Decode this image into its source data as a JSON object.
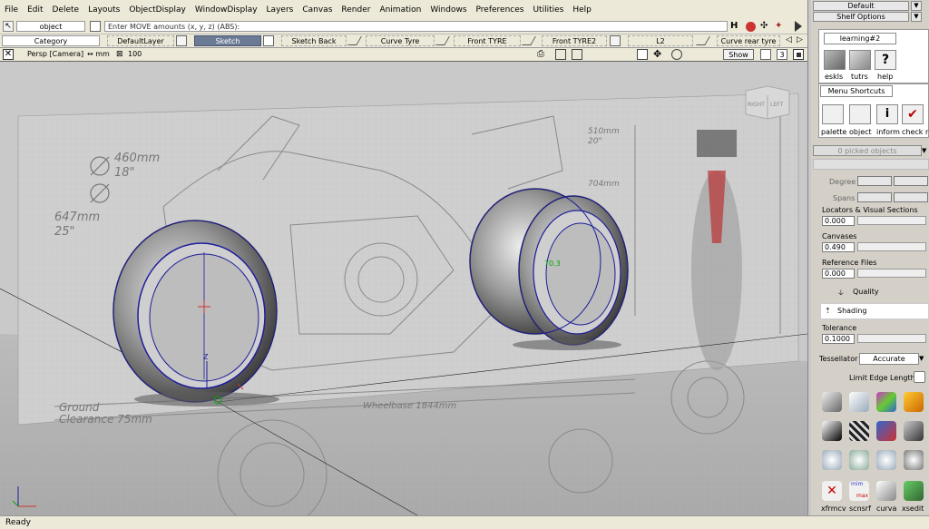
{
  "menu": [
    "File",
    "Edit",
    "Delete",
    "Layouts",
    "ObjectDisplay",
    "WindowDisplay",
    "Layers",
    "Canvas",
    "Render",
    "Animation",
    "Windows",
    "Preferences",
    "Utilities",
    "Help"
  ],
  "toolbar": {
    "pick_mode": "object",
    "move_prompt": "Enter MOVE amounts (x, y, z) (ABS):"
  },
  "layers": {
    "category": "Category",
    "items": [
      "DefaultLayer",
      "Sketch",
      "Sketch Back",
      "Curve Tyre",
      "Front TYRE",
      "Front TYRE2",
      "L2",
      "Curve rear tyre"
    ]
  },
  "viewport": {
    "camera": "Persp [Camera]",
    "units": "↔ mm",
    "zoom": "100",
    "show": "Show",
    "count": "3",
    "viewcube_faces": [
      "RIGHT",
      "LEFT"
    ],
    "annotations": [
      "460mm",
      "18\"",
      "647mm",
      "25\"",
      "510mm",
      "20\"",
      "704mm",
      "Ground",
      "Clearance 75mm",
      "Wheelbase 1844mm"
    ],
    "axis_label": "Z",
    "marker": "70.3"
  },
  "right_panel": {
    "layout": "Default",
    "shelf": "Shelf Options",
    "shelf_tab": "learning#2",
    "shelf_icons": [
      "eskls",
      "tutrs",
      "help"
    ],
    "menu_tab": "Menu Shortcuts",
    "menu_icons": [
      "palette",
      "object",
      "inform",
      "check r"
    ],
    "picked": "0 picked objects",
    "degree": "Degree",
    "spans": "Spans",
    "locators": "Locators & Visual Sections",
    "locators_val": "0.000",
    "canvases": "Canvases",
    "canvases_val": "0.490",
    "ref_files": "Reference Files",
    "ref_val": "0.000",
    "quality": "Quality",
    "shading": "Shading",
    "tolerance": "Tolerance",
    "tol_val": "0.1000",
    "tessellator": "Tessellator",
    "tess_val": "Accurate",
    "limit_edge": "Limit Edge Length",
    "bottom_icons": [
      "xfrmcv",
      "scnsrf",
      "curva",
      "xsedit"
    ],
    "bottom_badges": [
      "mim",
      "max"
    ]
  },
  "status": "Ready"
}
